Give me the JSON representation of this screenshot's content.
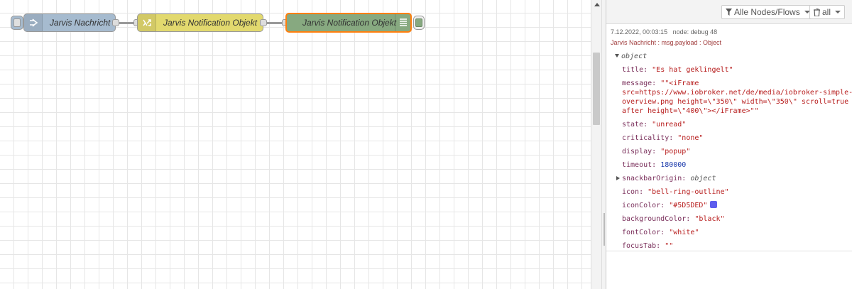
{
  "flow": {
    "nodes": [
      {
        "label": "Jarvis Nachricht",
        "icon": "inject-arrow-icon",
        "color": "#a6bbcf"
      },
      {
        "label": "Jarvis Notification Objekt",
        "icon": "change-shuffle-icon",
        "color": "#e2d96e"
      },
      {
        "label": "Jarvis Notification Objekt",
        "icon": "debug-list-icon",
        "color": "#87a980"
      }
    ]
  },
  "debug": {
    "filter_nodes_label": "Alle Nodes/Flows",
    "clear_label": "all",
    "message": {
      "timestamp": "7.12.2022, 00:03:15",
      "node": "node: debug 48",
      "path": "Jarvis Nachricht : msg.payload : Object",
      "root_label": "object",
      "props": {
        "title": {
          "key": "title:",
          "value": "\"Es hat geklingelt\""
        },
        "message": {
          "key": "message:",
          "value_lines": [
            "\"\"<iFrame",
            "src=https://www.iobroker.net/de/media/iobroker-simple-",
            "overview.png height=\\\"350\\\" width=\\\"350\\\" scroll=true",
            "after height=\\\"400\\\"></iFrame>\"\""
          ]
        },
        "state": {
          "key": "state:",
          "value": "\"unread\""
        },
        "criticality": {
          "key": "criticality:",
          "value": "\"none\""
        },
        "display": {
          "key": "display:",
          "value": "\"popup\""
        },
        "timeout": {
          "key": "timeout:",
          "value": "180000"
        },
        "snackbarOrigin": {
          "key": "snackbarOrigin:",
          "value": "object"
        },
        "icon": {
          "key": "icon:",
          "value": "\"bell-ring-outline\""
        },
        "iconColor": {
          "key": "iconColor:",
          "value": "\"#5D5DED\"",
          "swatch": "#5D5DED"
        },
        "backgroundColor": {
          "key": "backgroundColor:",
          "value": "\"black\""
        },
        "fontColor": {
          "key": "fontColor:",
          "value": "\"white\""
        },
        "focusTab": {
          "key": "focusTab:",
          "value": "\"\""
        }
      }
    }
  }
}
